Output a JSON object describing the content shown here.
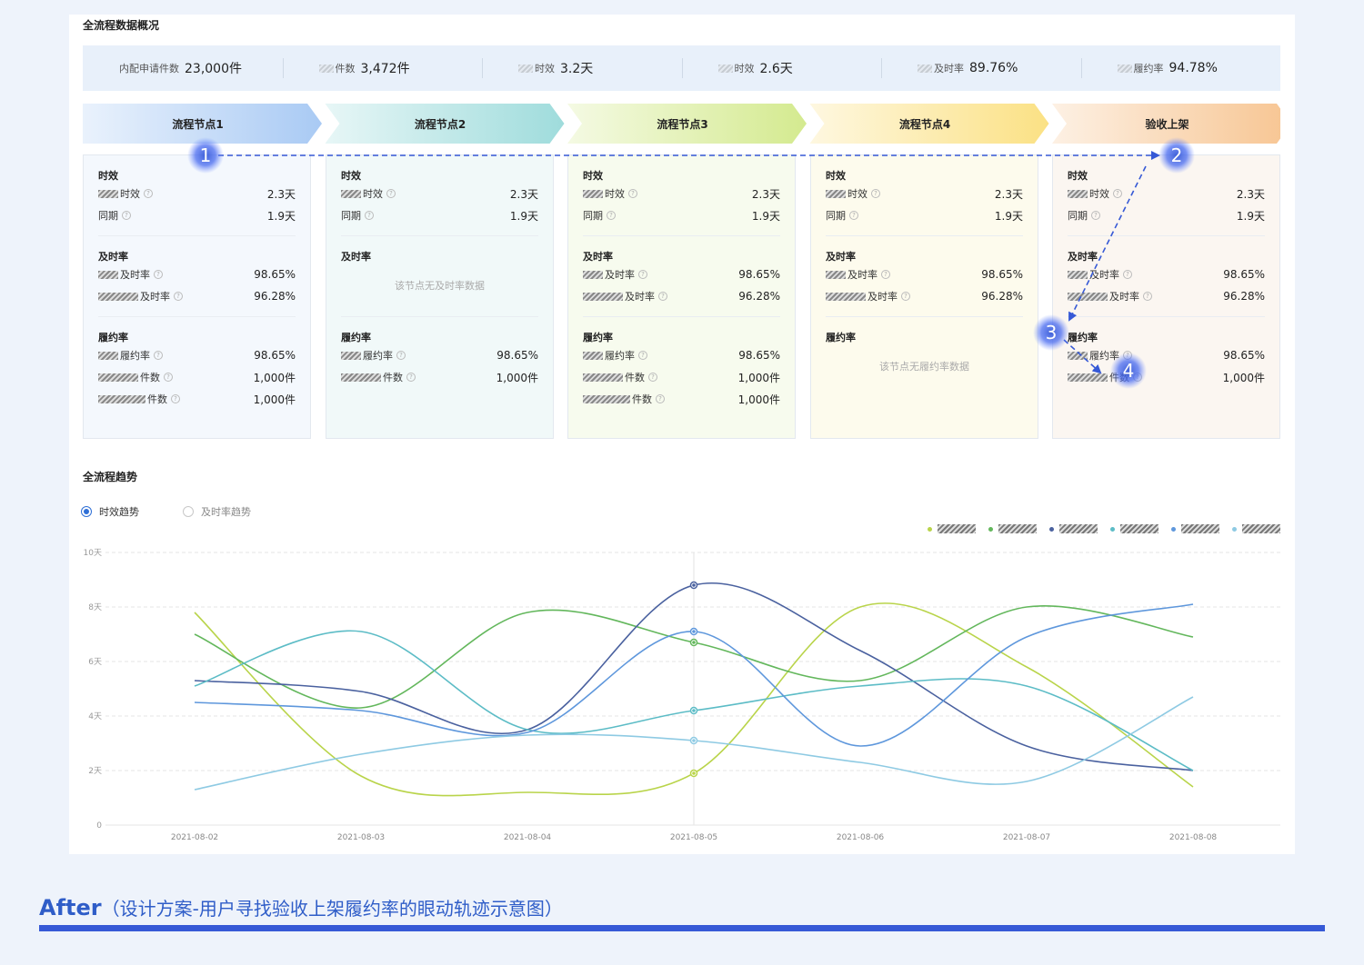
{
  "overview": {
    "title": "全流程数据概况",
    "stats": [
      {
        "label": "内配申请件数",
        "value": "23,000件",
        "masked": false
      },
      {
        "label": "件数",
        "value": "3,472件",
        "masked": true
      },
      {
        "label": "时效",
        "value": "3.2天",
        "masked": true
      },
      {
        "label": "时效",
        "value": "2.6天",
        "masked": true
      },
      {
        "label": "及时率",
        "value": "89.76%",
        "masked": true
      },
      {
        "label": "履约率",
        "value": "94.78%",
        "masked": true
      }
    ]
  },
  "nodes": [
    {
      "label": "流程节点1",
      "color": "#a9caf4",
      "timeliness": {
        "title": "时效",
        "rows": [
          {
            "label": "时效",
            "value": "2.3天"
          },
          {
            "label": "同期",
            "value": "1.9天"
          }
        ]
      },
      "ontime": {
        "title": "及时率",
        "rows": [
          {
            "label": "及时率",
            "value": "98.65%"
          },
          {
            "label": "及时率",
            "value": "96.28%"
          }
        ]
      },
      "fulfill": {
        "title": "履约率",
        "rows": [
          {
            "label": "履约率",
            "value": "98.65%"
          },
          {
            "label": "件数",
            "value": "1,000件"
          },
          {
            "label": "件数",
            "value": "1,000件"
          }
        ]
      }
    },
    {
      "label": "流程节点2",
      "color": "#9fdcdc",
      "timeliness": {
        "title": "时效",
        "rows": [
          {
            "label": "时效",
            "value": "2.3天"
          },
          {
            "label": "同期",
            "value": "1.9天"
          }
        ]
      },
      "ontime": {
        "title": "及时率",
        "empty": "该节点无及时率数据"
      },
      "fulfill": {
        "title": "履约率",
        "rows": [
          {
            "label": "履约率",
            "value": "98.65%"
          },
          {
            "label": "件数",
            "value": "1,000件"
          }
        ]
      }
    },
    {
      "label": "流程节点3",
      "color": "#d4ea8f",
      "timeliness": {
        "title": "时效",
        "rows": [
          {
            "label": "时效",
            "value": "2.3天"
          },
          {
            "label": "同期",
            "value": "1.9天"
          }
        ]
      },
      "ontime": {
        "title": "及时率",
        "rows": [
          {
            "label": "及时率",
            "value": "98.65%"
          },
          {
            "label": "及时率",
            "value": "96.28%"
          }
        ]
      },
      "fulfill": {
        "title": "履约率",
        "rows": [
          {
            "label": "履约率",
            "value": "98.65%"
          },
          {
            "label": "件数",
            "value": "1,000件"
          },
          {
            "label": "件数",
            "value": "1,000件"
          }
        ]
      }
    },
    {
      "label": "流程节点4",
      "color": "#fbe184",
      "timeliness": {
        "title": "时效",
        "rows": [
          {
            "label": "时效",
            "value": "2.3天"
          },
          {
            "label": "同期",
            "value": "1.9天"
          }
        ]
      },
      "ontime": {
        "title": "及时率",
        "rows": [
          {
            "label": "及时率",
            "value": "98.65%"
          },
          {
            "label": "及时率",
            "value": "96.28%"
          }
        ]
      },
      "fulfill": {
        "title": "履约率",
        "empty": "该节点无履约率数据"
      }
    },
    {
      "label": "验收上架",
      "color": "#f7c592",
      "timeliness": {
        "title": "时效",
        "rows": [
          {
            "label": "时效",
            "value": "2.3天"
          },
          {
            "label": "同期",
            "value": "1.9天"
          }
        ]
      },
      "ontime": {
        "title": "及时率",
        "rows": [
          {
            "label": "及时率",
            "value": "98.65%"
          },
          {
            "label": "及时率",
            "value": "96.28%"
          }
        ]
      },
      "fulfill": {
        "title": "履约率",
        "rows": [
          {
            "label": "履约率",
            "value": "98.65%"
          },
          {
            "label": "件数",
            "value": "1,000件"
          }
        ]
      }
    }
  ],
  "eye_tracking": {
    "markers": [
      "1",
      "2",
      "3",
      "4"
    ],
    "color": "#3659d6"
  },
  "trend": {
    "title": "全流程趋势",
    "options": [
      {
        "label": "时效趋势",
        "selected": true
      },
      {
        "label": "及时率趋势",
        "selected": false
      }
    ]
  },
  "chart_data": {
    "type": "line",
    "x": [
      "2021-08-02",
      "2021-08-03",
      "2021-08-04",
      "2021-08-05",
      "2021-08-06",
      "2021-08-07",
      "2021-08-08"
    ],
    "ylim": [
      0,
      10
    ],
    "yticks": [
      "0",
      "2天",
      "4天",
      "6天",
      "8天",
      "10天"
    ],
    "grid": true,
    "legend_position": "top-right",
    "highlight_x": "2021-08-05",
    "series": [
      {
        "color": "#b9d44a",
        "values": [
          7.8,
          1.8,
          1.2,
          1.9,
          8.0,
          5.8,
          1.4
        ]
      },
      {
        "color": "#63b75c",
        "values": [
          7.0,
          4.3,
          7.8,
          6.7,
          5.3,
          8.0,
          6.9
        ]
      },
      {
        "color": "#4a619f",
        "values": [
          5.3,
          4.9,
          3.5,
          8.8,
          6.4,
          2.9,
          2.0
        ]
      },
      {
        "color": "#5cbcc6",
        "values": [
          5.1,
          7.1,
          3.5,
          4.2,
          5.1,
          5.1,
          2.0
        ]
      },
      {
        "color": "#5e97dc",
        "values": [
          4.5,
          4.2,
          3.4,
          7.1,
          2.9,
          6.9,
          8.1
        ]
      },
      {
        "color": "#8ecae3",
        "values": [
          1.3,
          2.6,
          3.3,
          3.1,
          2.3,
          1.6,
          4.7
        ]
      }
    ]
  },
  "footer": {
    "title": "After",
    "subtitle": "（设计方案-用户寻找验收上架履约率的眼动轨迹示意图）"
  }
}
